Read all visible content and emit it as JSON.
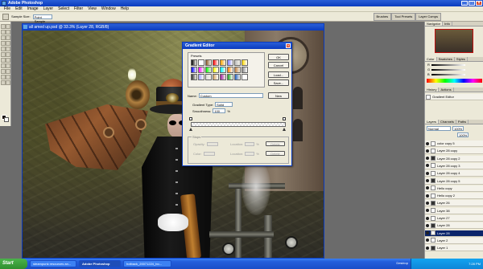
{
  "window": {
    "title": "Adobe Photoshop"
  },
  "menu": [
    "File",
    "Edit",
    "Image",
    "Layer",
    "Select",
    "Filter",
    "View",
    "Window",
    "Help"
  ],
  "options": {
    "sample_size_label": "Sample Size:",
    "sample_size_value": "Point Sample",
    "wells": [
      "Brushes",
      "Tool Presets",
      "Layer Comps"
    ]
  },
  "document": {
    "title": "all amed up.psd @ 33.3% (Layer 28, RGB/8)"
  },
  "gradient_editor": {
    "title": "Gradient Editor",
    "presets_label": "Presets",
    "buttons": {
      "ok": "OK",
      "cancel": "Cancel",
      "load": "Load...",
      "save": "Save..."
    },
    "name_label": "Name:",
    "name_value": "Custom",
    "new_button": "New",
    "gradient_type_label": "Gradient Type:",
    "gradient_type_value": "Solid",
    "smoothness_label": "Smoothness:",
    "smoothness_value": "100",
    "smoothness_unit": "%",
    "stops_legend": "Stops",
    "opacity_label": "Opacity:",
    "color_label": "Color:",
    "location_label": "Location:",
    "location_unit": "%",
    "delete_button": "Delete",
    "presets": [
      "#000000",
      "#ffffff",
      "#8a5a2a",
      "#ff0000",
      "#ffa500",
      "#7f7fff",
      "#c0c0c0",
      "#ffd700",
      "#0000ff",
      "#ff00ff",
      "#00ff00",
      "#ffff00",
      "#00ffff",
      "#ff8000",
      "#c08040",
      "#888888",
      "#303030",
      "#a0a0ff",
      "#e0e0e0",
      "#d0a060",
      "#a020a0",
      "#20a020",
      "#2060c0",
      "#ffffff"
    ]
  },
  "panels": {
    "navigator_tabs": [
      "Navigator",
      "Info"
    ],
    "color_tabs": [
      "Color",
      "Swatches",
      "Styles"
    ],
    "history_tabs": [
      "History",
      "Actions"
    ],
    "history_item": "Gradient Editor",
    "layers_tabs": [
      "Layers",
      "Channels",
      "Paths"
    ],
    "blend_mode": "Normal",
    "opacity": "100%",
    "fill": "100%",
    "color_channels": [
      "R",
      "G",
      "B"
    ],
    "layers": [
      "color copy 5",
      "Layer 28 copy",
      "Layer 28 copy 2",
      "Layer 28 copy 3",
      "Layer 28 copy 4",
      "Layer 28 copy 5",
      "Hello copy",
      "Hello copy 2",
      "Layer 26",
      "Layer 38",
      "Layer 27",
      "Layer 28",
      "Layer 28",
      "Layer 2",
      "Layer 1"
    ],
    "selected_layer_index": 12
  },
  "taskbar": {
    "start": "Start",
    "items": [
      "steampunk resources an...",
      "Adobe Photoshop",
      "hotback_20071224_bo..."
    ],
    "active_index": 1,
    "desktop": "Desktop",
    "time": "7:28 PM"
  }
}
